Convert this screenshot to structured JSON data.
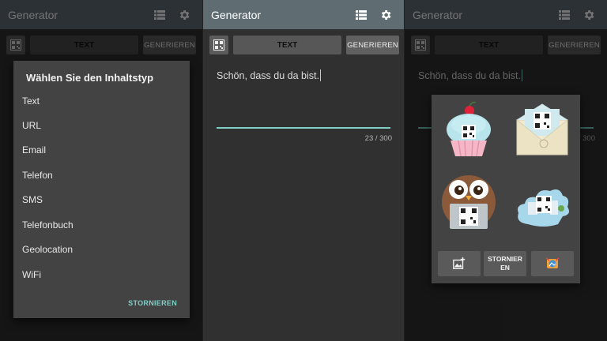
{
  "app": {
    "title": "Generator"
  },
  "toolbar": {
    "type_label": "TEXT",
    "generate_label": "GENERIEREN"
  },
  "editor": {
    "text": "Schön, dass du da bist.",
    "counter": "23 / 300"
  },
  "content_type_dialog": {
    "title": "Wählen Sie den Inhaltstyp",
    "options": [
      "Text",
      "URL",
      "Email",
      "Telefon",
      "SMS",
      "Telefonbuch",
      "Geolocation",
      "WiFi"
    ],
    "cancel_label": "STORNIEREN"
  },
  "template_dialog": {
    "templates": [
      "cupcake-qr-icon",
      "envelope-qr-icon",
      "owl-laptop-qr-icon",
      "city-cloud-qr-icon"
    ],
    "add_image_icon": "add-image-icon",
    "cancel_label_line1": "STORNIER",
    "cancel_label_line2": "EN",
    "gallery_icon": "gallery-icon"
  },
  "colors": {
    "app_bar": "#5f6d73",
    "accent": "#7fcfc6",
    "background": "#303030",
    "dialog": "#434343"
  }
}
